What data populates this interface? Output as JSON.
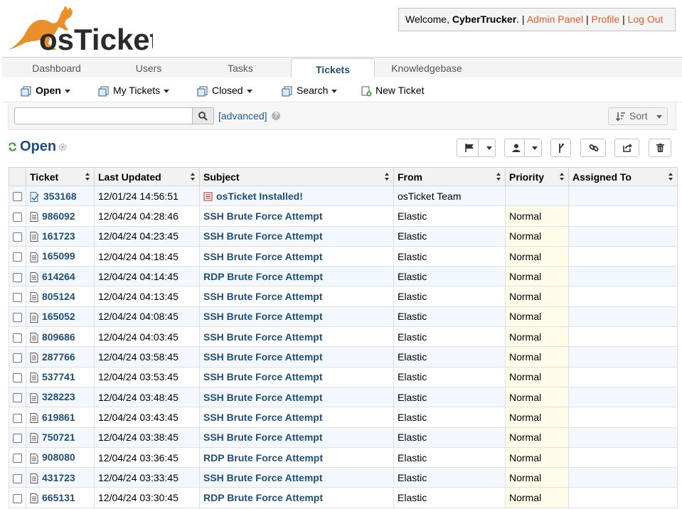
{
  "app": {
    "logo_text": "osTicket"
  },
  "header": {
    "welcome_prefix": "Welcome, ",
    "username": "CyberTrucker",
    "sep1": ". | ",
    "admin_panel": "Admin Panel",
    "sep2": " | ",
    "profile": "Profile",
    "sep3": " | ",
    "logout": "Log Out"
  },
  "nav": {
    "tabs": [
      {
        "label": "Dashboard"
      },
      {
        "label": "Users"
      },
      {
        "label": "Tasks"
      },
      {
        "label": "Tickets",
        "active": true
      },
      {
        "label": "Knowledgebase"
      }
    ]
  },
  "subnav": {
    "open": "Open",
    "my_tickets": "My Tickets",
    "closed": "Closed",
    "search": "Search",
    "new_ticket": "New Ticket"
  },
  "search": {
    "value": "",
    "placeholder": "",
    "advanced": "[advanced]",
    "help": "?",
    "sort": "Sort"
  },
  "queue": {
    "title": "Open"
  },
  "table": {
    "headers": {
      "ticket": "Ticket",
      "last_updated": "Last Updated",
      "subject": "Subject",
      "from": "From",
      "priority": "Priority",
      "assigned_to": "Assigned To"
    },
    "rows": [
      {
        "number": "353168",
        "updated": "12/01/24 14:56:51",
        "subject": "osTicket Installed!",
        "from": "osTicket Team",
        "priority": "",
        "assigned": ""
      },
      {
        "number": "986092",
        "updated": "12/04/24 04:28:46",
        "subject": "SSH Brute Force Attempt",
        "from": "Elastic",
        "priority": "Normal",
        "assigned": ""
      },
      {
        "number": "161723",
        "updated": "12/04/24 04:23:45",
        "subject": "SSH Brute Force Attempt",
        "from": "Elastic",
        "priority": "Normal",
        "assigned": ""
      },
      {
        "number": "165099",
        "updated": "12/04/24 04:18:45",
        "subject": "SSH Brute Force Attempt",
        "from": "Elastic",
        "priority": "Normal",
        "assigned": ""
      },
      {
        "number": "614264",
        "updated": "12/04/24 04:14:45",
        "subject": "RDP Brute Force Attempt",
        "from": "Elastic",
        "priority": "Normal",
        "assigned": ""
      },
      {
        "number": "805124",
        "updated": "12/04/24 04:13:45",
        "subject": "SSH Brute Force Attempt",
        "from": "Elastic",
        "priority": "Normal",
        "assigned": ""
      },
      {
        "number": "165052",
        "updated": "12/04/24 04:08:45",
        "subject": "SSH Brute Force Attempt",
        "from": "Elastic",
        "priority": "Normal",
        "assigned": ""
      },
      {
        "number": "809686",
        "updated": "12/04/24 04:03:45",
        "subject": "SSH Brute Force Attempt",
        "from": "Elastic",
        "priority": "Normal",
        "assigned": ""
      },
      {
        "number": "287766",
        "updated": "12/04/24 03:58:45",
        "subject": "SSH Brute Force Attempt",
        "from": "Elastic",
        "priority": "Normal",
        "assigned": ""
      },
      {
        "number": "537741",
        "updated": "12/04/24 03:53:45",
        "subject": "SSH Brute Force Attempt",
        "from": "Elastic",
        "priority": "Normal",
        "assigned": ""
      },
      {
        "number": "328223",
        "updated": "12/04/24 03:48:45",
        "subject": "SSH Brute Force Attempt",
        "from": "Elastic",
        "priority": "Normal",
        "assigned": ""
      },
      {
        "number": "619861",
        "updated": "12/04/24 03:43:45",
        "subject": "SSH Brute Force Attempt",
        "from": "Elastic",
        "priority": "Normal",
        "assigned": ""
      },
      {
        "number": "750721",
        "updated": "12/04/24 03:38:45",
        "subject": "SSH Brute Force Attempt",
        "from": "Elastic",
        "priority": "Normal",
        "assigned": ""
      },
      {
        "number": "908080",
        "updated": "12/04/24 03:36:45",
        "subject": "RDP Brute Force Attempt",
        "from": "Elastic",
        "priority": "Normal",
        "assigned": ""
      },
      {
        "number": "431723",
        "updated": "12/04/24 03:33:45",
        "subject": "SSH Brute Force Attempt",
        "from": "Elastic",
        "priority": "Normal",
        "assigned": ""
      },
      {
        "number": "665131",
        "updated": "12/04/24 03:30:45",
        "subject": "RDP Brute Force Attempt",
        "from": "Elastic",
        "priority": "Normal",
        "assigned": ""
      }
    ]
  },
  "colors": {
    "brand_orange": "#e9902d",
    "link_blue": "#1f4e79",
    "header_link": "#e05e2c"
  },
  "icons": {
    "logo": "kangaroo-icon",
    "refresh": "refresh-icon",
    "settings": "gear-icon",
    "search": "search-icon",
    "sort": "sort-icon"
  }
}
